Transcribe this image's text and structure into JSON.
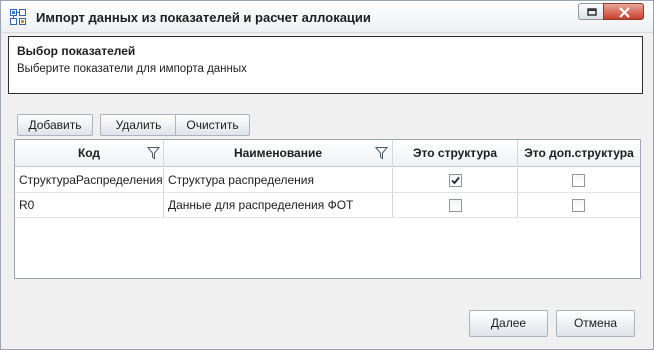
{
  "window": {
    "title": "Импорт данных из показателей и расчет аллокации"
  },
  "header": {
    "title": "Выбор показателей",
    "subtitle": "Выберите показатели для импорта данных"
  },
  "toolbar": {
    "add_label": "Добавить",
    "delete_label": "Удалить",
    "clear_label": "Очистить"
  },
  "grid": {
    "columns": [
      "Код",
      "Наименование",
      "Это структура",
      "Это доп.структура"
    ],
    "rows": [
      {
        "code": "СтруктураРаспределения",
        "name": "Структура распределения",
        "is_structure": true,
        "is_extra_structure": false
      },
      {
        "code": "R0",
        "name": "Данные для распределения ФОТ",
        "is_structure": false,
        "is_extra_structure": false
      }
    ]
  },
  "footer": {
    "next_label": "Далее",
    "cancel_label": "Отмена"
  },
  "icons": {
    "app": "grid-structure-icon",
    "restore": "restore-window-icon",
    "close": "close-icon",
    "filter": "filter-icon",
    "checkmark": "check-icon"
  },
  "colors": {
    "close_button": "#c8402b",
    "panel_border": "#2f2f2f"
  }
}
